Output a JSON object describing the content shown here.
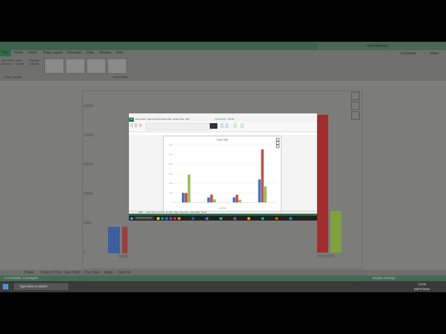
{
  "background_window": {
    "ribbon_tabs": [
      "File",
      "Home",
      "Insert",
      "Page Layout",
      "Formulas",
      "Data",
      "Review",
      "View"
    ],
    "account": "Nana Boateng",
    "comments_label": "Comments",
    "share_label": "Share",
    "add_chart_label": "Add Chart Element",
    "quick_layout_label": "Quick Layout",
    "change_colors_label": "Change Colours",
    "chart_layouts_group": "Chart Layouts",
    "chart_styles_group": "Chart Styles",
    "y_ticks": [
      "30000",
      "25000",
      "20000",
      "15000",
      "10000",
      "5000",
      "0"
    ],
    "sheet_tabs": [
      "Chart",
      "Column Chart",
      "Line Chart",
      "Pie Chart",
      "Magic",
      "Chart Sh"
    ],
    "status_left": "Accessibility: Investigate",
    "display_settings": "Display Settings",
    "taskbar_search": "Type here to search",
    "taskbar_time": "14:55",
    "taskbar_date": "26/07/2023",
    "x_label_left": "31/05/...",
    "x_label_right": "29/07/2023"
  },
  "foreground_window": {
    "ribbon_tabs": [
      "File",
      "Home",
      "Insert",
      "Page Layout",
      "Formulas",
      "Data",
      "Review",
      "View",
      "Help",
      "Chart Design",
      "Format"
    ],
    "sheet_tabs": [
      "Chart",
      "Column Chart",
      "Line Chart",
      "Pie Chart",
      "Magic",
      "Chart Sheet",
      "Data Analysis",
      "Sheet1"
    ],
    "taskbar_search": "Type here to search",
    "chart_title": "Chart Title",
    "axis_title": "Axis Title"
  },
  "chart_data": {
    "type": "bar",
    "title": "Chart Title",
    "ylim": [
      0,
      30000
    ],
    "yticks": [
      0,
      5000,
      10000,
      15000,
      20000,
      25000,
      30000
    ],
    "categories": [
      "",
      "",
      "",
      ""
    ],
    "series": [
      {
        "color": "#4472c4",
        "values": [
          5000,
          2600,
          2700,
          12000
        ]
      },
      {
        "color": "#c0504d",
        "values": [
          4900,
          4100,
          4000,
          27600
        ]
      },
      {
        "color": "#9bbb59",
        "values": [
          14500,
          1700,
          1500,
          8400
        ]
      }
    ],
    "grid": true,
    "legend": "none"
  },
  "colors": {
    "excel_green": "#217346",
    "series_blue": "#4472c4",
    "series_red": "#c0504d",
    "series_green": "#9bbb59"
  }
}
